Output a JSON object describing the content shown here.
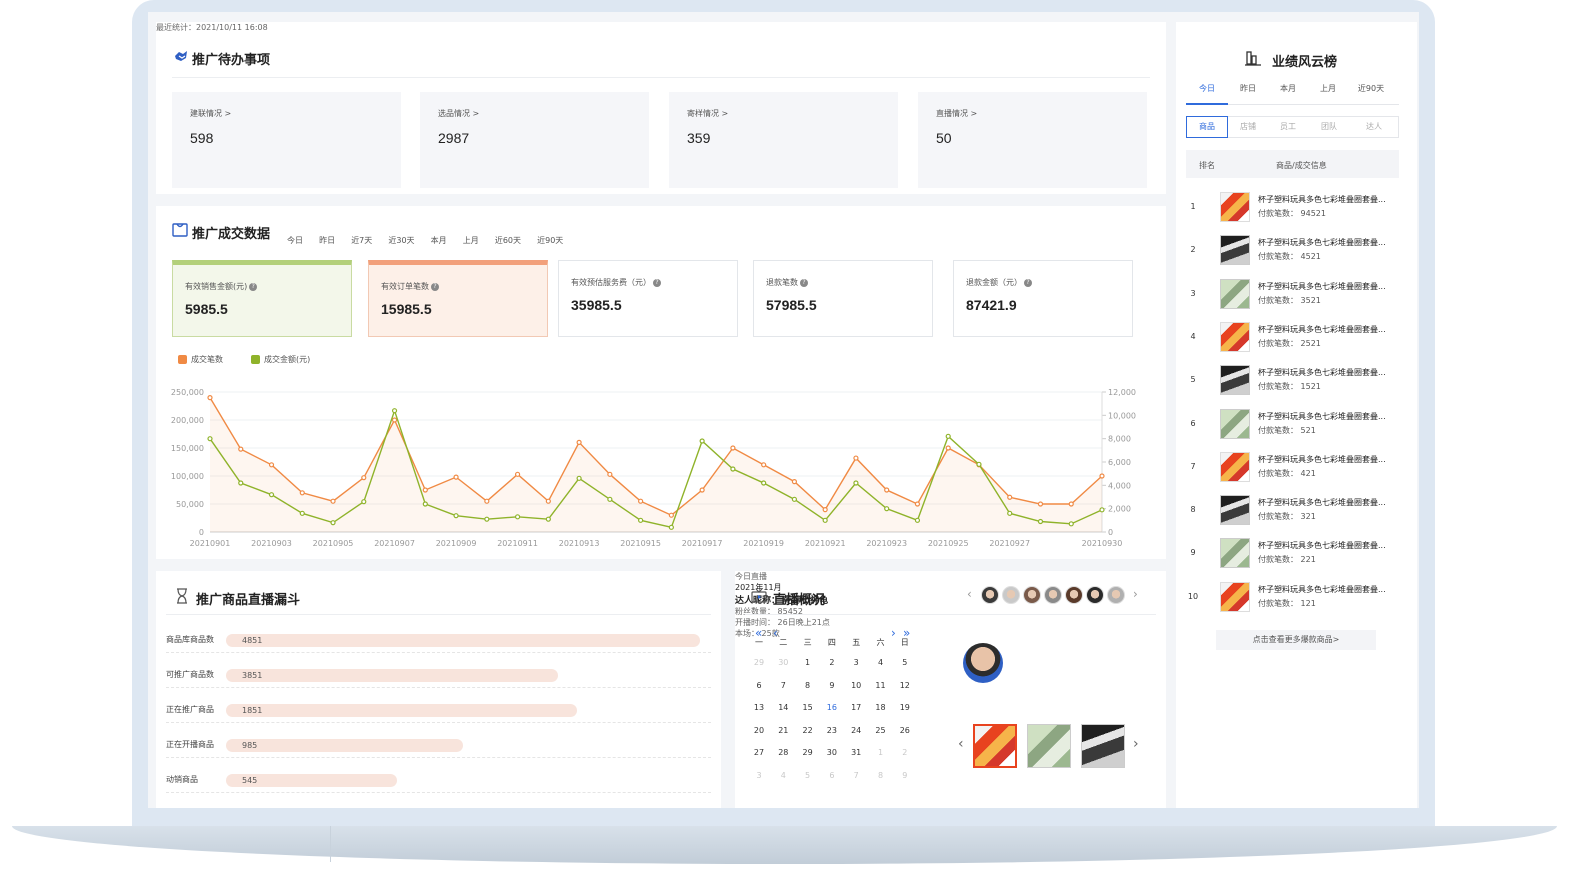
{
  "todo": {
    "title": "推广待办事项",
    "stat_time": "最近统计：2021/10/11 16:08",
    "cards": [
      {
        "label": "建联情况 >",
        "value": "598"
      },
      {
        "label": "选品情况 >",
        "value": "2987"
      },
      {
        "label": "寄样情况 >",
        "value": "359"
      },
      {
        "label": "直播情况 >",
        "value": "50"
      }
    ]
  },
  "deal": {
    "title": "推广成交数据",
    "tabs": [
      "今日",
      "昨日",
      "近7天",
      "近30天",
      "本月",
      "上月",
      "近60天",
      "近90天"
    ],
    "kpis": [
      {
        "label": "有效销售金额(元)",
        "value": "5985.5"
      },
      {
        "label": "有效订单笔数",
        "value": "15985.5"
      },
      {
        "label": "有效预估服务费（元）",
        "value": "35985.5"
      },
      {
        "label": "退款笔数",
        "value": "57985.5"
      },
      {
        "label": "退款金额（元）",
        "value": "87421.9"
      }
    ]
  },
  "chart_data": {
    "type": "line",
    "x": [
      "20210901",
      "20210902",
      "20210903",
      "20210904",
      "20210905",
      "20210906",
      "20210907",
      "20210908",
      "20210909",
      "20210910",
      "20210911",
      "20210912",
      "20210913",
      "20210914",
      "20210915",
      "20210916",
      "20210917",
      "20210918",
      "20210919",
      "20210920",
      "20210921",
      "20210922",
      "20210923",
      "20210924",
      "20210925",
      "20210926",
      "20210927",
      "20210928",
      "20210929",
      "20210930"
    ],
    "x_tick_labels": [
      "20210901",
      "20210903",
      "20210905",
      "20210907",
      "20210909",
      "20210911",
      "20210913",
      "20210915",
      "20210917",
      "20210919",
      "20210921",
      "20210923",
      "20210925",
      "20210927",
      "20210930"
    ],
    "y_left_ticks": [
      "0",
      "50,000",
      "100,000",
      "150,000",
      "200,000",
      "250,000"
    ],
    "y_right_ticks": [
      "0",
      "2,000",
      "4,000",
      "6,000",
      "8,000",
      "10,000",
      "12,000"
    ],
    "ylim_left": [
      0,
      250000
    ],
    "ylim_right": [
      0,
      12000
    ],
    "series": [
      {
        "name": "成交笔数",
        "color": "#f08a44",
        "axis": "left",
        "values": [
          240000,
          148000,
          120000,
          70000,
          55000,
          97000,
          200000,
          75000,
          98000,
          55000,
          103000,
          55000,
          160000,
          103000,
          55000,
          30000,
          75000,
          150000,
          120000,
          90000,
          40000,
          132000,
          75000,
          50000,
          150000,
          120000,
          62000,
          50000,
          50000,
          100000
        ]
      },
      {
        "name": "成交金额(元)",
        "color": "#8fb32a",
        "axis": "right",
        "values": [
          8000,
          4200,
          3200,
          1600,
          800,
          2600,
          10400,
          2400,
          1400,
          1100,
          1300,
          1100,
          4600,
          2800,
          1000,
          400,
          7800,
          5400,
          4200,
          2800,
          1000,
          4200,
          2000,
          1000,
          8200,
          5800,
          1600,
          900,
          700,
          1900
        ]
      }
    ]
  },
  "funnel": {
    "title": "推广商品直播漏斗",
    "rows": [
      {
        "label": "商品库商品数",
        "value": "4851",
        "ratio": 1.0
      },
      {
        "label": "可推广商品数",
        "value": "3851",
        "ratio": 0.7
      },
      {
        "label": "正在推广商品",
        "value": "1851",
        "ratio": 0.74
      },
      {
        "label": "正在开播商品",
        "value": "985",
        "ratio": 0.5
      },
      {
        "label": "动销商品",
        "value": "545",
        "ratio": 0.36
      }
    ]
  },
  "live": {
    "title": "直播概况",
    "today_label": "今日直播",
    "avatar_colors": [
      "#3a3a3a",
      "#c9c9c9",
      "#7a5a4a",
      "#8a8a8a",
      "#5a3a2a",
      "#2a2a2a",
      "#b0b0b0"
    ],
    "calendar": {
      "month": "2021年11月",
      "weekdays": [
        "一",
        "二",
        "三",
        "四",
        "五",
        "六",
        "日"
      ],
      "weeks": [
        [
          {
            "d": "29",
            "dim": true
          },
          {
            "d": "30",
            "dim": true
          },
          {
            "d": "1"
          },
          {
            "d": "2"
          },
          {
            "d": "3"
          },
          {
            "d": "4"
          },
          {
            "d": "5"
          }
        ],
        [
          {
            "d": "6"
          },
          {
            "d": "7"
          },
          {
            "d": "8"
          },
          {
            "d": "9"
          },
          {
            "d": "10"
          },
          {
            "d": "11"
          },
          {
            "d": "12"
          }
        ],
        [
          {
            "d": "13"
          },
          {
            "d": "14"
          },
          {
            "d": "15"
          },
          {
            "d": "16",
            "today": true
          },
          {
            "d": "17"
          },
          {
            "d": "18"
          },
          {
            "d": "19"
          }
        ],
        [
          {
            "d": "20"
          },
          {
            "d": "21"
          },
          {
            "d": "22"
          },
          {
            "d": "23"
          },
          {
            "d": "24"
          },
          {
            "d": "25"
          },
          {
            "d": "26"
          }
        ],
        [
          {
            "d": "27"
          },
          {
            "d": "28"
          },
          {
            "d": "29"
          },
          {
            "d": "30"
          },
          {
            "d": "31"
          },
          {
            "d": "1",
            "dim": true
          },
          {
            "d": "2",
            "dim": true
          }
        ],
        [
          {
            "d": "3",
            "dim": true
          },
          {
            "d": "4",
            "dim": true
          },
          {
            "d": "5",
            "dim": true
          },
          {
            "d": "6",
            "dim": true
          },
          {
            "d": "7",
            "dim": true
          },
          {
            "d": "8",
            "dim": true
          },
          {
            "d": "9",
            "dim": true
          }
        ]
      ]
    },
    "talent": {
      "nickname": "达人昵称：  乾坤小神龟",
      "fans": "粉丝数量：  85452",
      "time": "开播时间：  26日晚上21点",
      "this_show": "本场：  25款"
    }
  },
  "rank": {
    "title": "业绩风云榜",
    "period_tabs": [
      "今日",
      "昨日",
      "本月",
      "上月",
      "近90天"
    ],
    "type_tabs": [
      "商品",
      "店铺",
      "员工",
      "团队",
      "达人"
    ],
    "col_rank": "排名",
    "col_info": "商品/成交信息",
    "items": [
      {
        "no": "1",
        "name": "杯子塑料玩具多色七彩堆叠圈套叠...",
        "count": "付款笔数：  94521",
        "thumb": "a"
      },
      {
        "no": "2",
        "name": "杯子塑料玩具多色七彩堆叠圈套叠...",
        "count": "付款笔数：  4521",
        "thumb": "b"
      },
      {
        "no": "3",
        "name": "杯子塑料玩具多色七彩堆叠圈套叠...",
        "count": "付款笔数：  3521",
        "thumb": "c"
      },
      {
        "no": "4",
        "name": "杯子塑料玩具多色七彩堆叠圈套叠...",
        "count": "付款笔数：  2521",
        "thumb": "a"
      },
      {
        "no": "5",
        "name": "杯子塑料玩具多色七彩堆叠圈套叠...",
        "count": "付款笔数：  1521",
        "thumb": "b"
      },
      {
        "no": "6",
        "name": "杯子塑料玩具多色七彩堆叠圈套叠...",
        "count": "付款笔数：  521",
        "thumb": "c"
      },
      {
        "no": "7",
        "name": "杯子塑料玩具多色七彩堆叠圈套叠...",
        "count": "付款笔数：  421",
        "thumb": "a"
      },
      {
        "no": "8",
        "name": "杯子塑料玩具多色七彩堆叠圈套叠...",
        "count": "付款笔数：  321",
        "thumb": "b"
      },
      {
        "no": "9",
        "name": "杯子塑料玩具多色七彩堆叠圈套叠...",
        "count": "付款笔数：  221",
        "thumb": "c"
      },
      {
        "no": "10",
        "name": "杯子塑料玩具多色七彩堆叠圈套叠...",
        "count": "付款笔数：  121",
        "thumb": "a"
      }
    ],
    "more_label": "点击查看更多爆款商品>"
  }
}
